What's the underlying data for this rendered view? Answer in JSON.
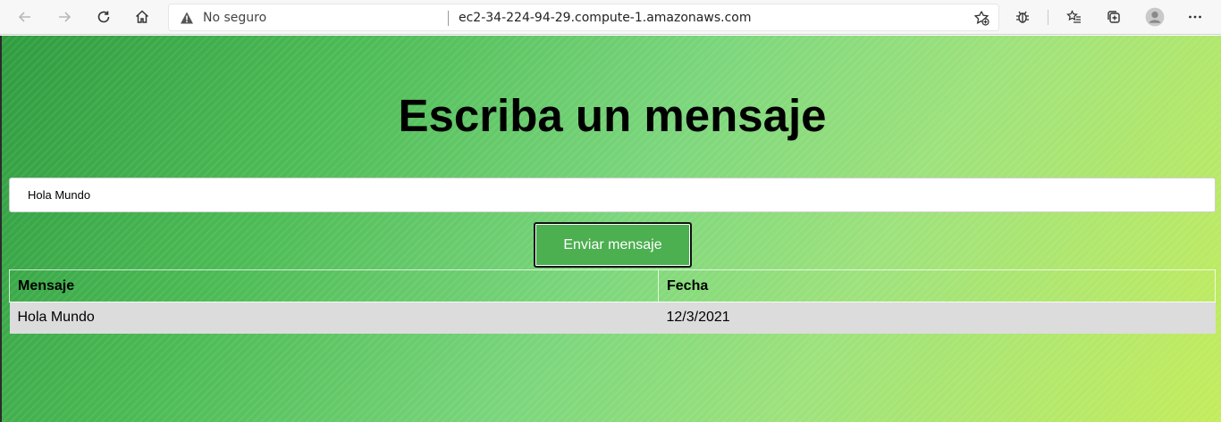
{
  "browser": {
    "security_label": "No seguro",
    "url": "ec2-34-224-94-29.compute-1.amazonaws.com"
  },
  "page": {
    "heading": "Escriba un mensaje",
    "input_value": "Hola Mundo",
    "send_button": "Enviar mensaje",
    "table": {
      "headers": [
        "Mensaje",
        "Fecha"
      ],
      "rows": [
        {
          "mensaje": "Hola Mundo",
          "fecha": "12/3/2021"
        }
      ]
    }
  }
}
